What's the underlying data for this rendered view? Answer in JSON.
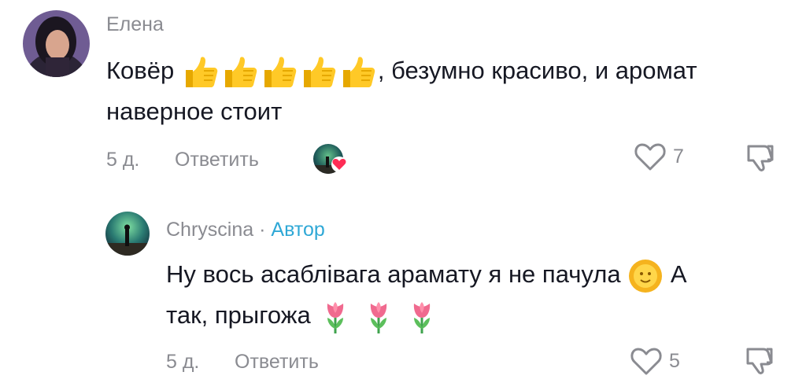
{
  "comment1": {
    "author": "Елена",
    "text_before": "Ковёр ",
    "emoji_thumbs": [
      "thumbs-up",
      "thumbs-up",
      "thumbs-up",
      "thumbs-up",
      "thumbs-up"
    ],
    "text_after_line1": ", безумно красиво, и аромат",
    "text_line2": "наверное стоит",
    "age": "5 д.",
    "reply_label": "Ответить",
    "likes": "7",
    "liked_by_creator_icon": "creator-liked-avatar"
  },
  "comment2": {
    "author": "Chryscina",
    "separator": "·",
    "author_badge": "Автор",
    "text_line1": "Ну вось асаблівага арамату я не пачула",
    "text_line1_end": "А",
    "text_line2": "так, прыгожа",
    "emojis_line1": [
      "sun-with-face"
    ],
    "emojis_line2": [
      "tulip",
      "tulip",
      "tulip"
    ],
    "age": "5 д.",
    "reply_label": "Ответить",
    "likes": "5"
  },
  "colors": {
    "muted": "#8a8b91",
    "text": "#161823",
    "author_badge": "#2fa8d6",
    "heart_red": "#fe2c55"
  },
  "icons": [
    "heart-outline-icon",
    "thumbs-down-icon"
  ]
}
